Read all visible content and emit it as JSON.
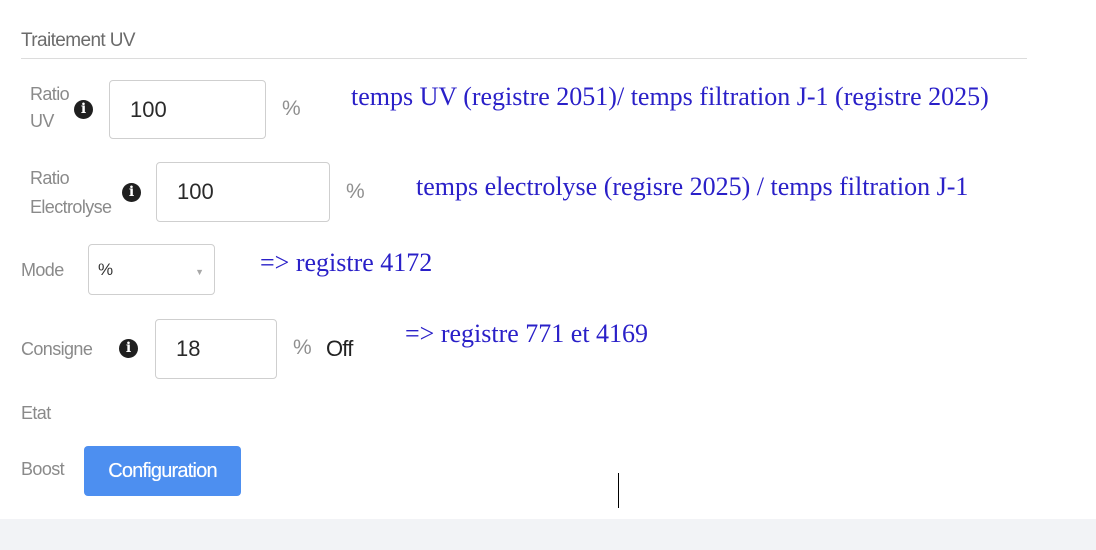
{
  "section": {
    "title": "Traitement UV"
  },
  "ratio_uv": {
    "label_line1": "Ratio",
    "label_line2": "UV",
    "info_icon": "info-icon",
    "value": "100",
    "unit": "%"
  },
  "ratio_electrolyse": {
    "label_line1": "Ratio",
    "label_line2": "Electrolyse",
    "info_icon": "info-icon",
    "value": "100",
    "unit": "%"
  },
  "mode": {
    "label": "Mode",
    "selected": "%"
  },
  "consigne": {
    "label": "Consigne",
    "info_icon": "info-icon",
    "value": "18",
    "unit": "%",
    "status": "Off"
  },
  "etat": {
    "label": "Etat"
  },
  "boost": {
    "label": "Boost",
    "button_label": "Configuration"
  },
  "annotations": {
    "ratio_uv": "temps UV (registre 2051)/ temps filtration J-1 (registre 2025)",
    "ratio_electrolyse": "temps electrolyse (regisre 2025) / temps filtration J-1",
    "mode": "=> registre 4172",
    "consigne": "=> registre 771 et  4169"
  },
  "colors": {
    "accent_button": "#4d8ff0",
    "annotation_text": "#2a20c8",
    "label_text": "#8a8a8a"
  }
}
